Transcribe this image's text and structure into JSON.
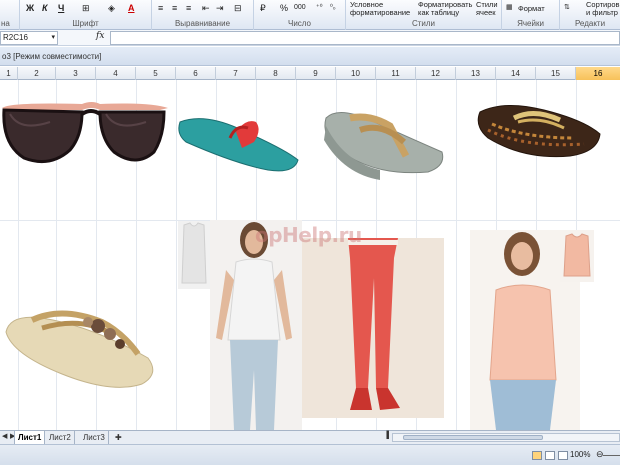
{
  "ribbon": {
    "groups": [
      {
        "label": "на"
      },
      {
        "label": "Шрифт"
      },
      {
        "label": "Выравнивание"
      },
      {
        "label": "Число"
      },
      {
        "label": "Стили"
      },
      {
        "label": "Ячейки"
      },
      {
        "label": "Редакти"
      }
    ],
    "font_buttons": {
      "bold": "Ж",
      "italic": "К",
      "underline": "Ч",
      "color_a": "А"
    },
    "number_buttons": {
      "percent": "%",
      "thousands": "000"
    },
    "styles": {
      "conditional": "Условное форматирование",
      "as_table": "Форматировать как таблицу",
      "cell_styles": "Стили ячеек"
    },
    "cells": {
      "format": "Формат"
    },
    "editing": {
      "sort": "Сортиров и фильтр"
    }
  },
  "formula_bar": {
    "name_box": "R2C16",
    "fx": "fx",
    "formula": ""
  },
  "workbook": {
    "title": "о3  [Режим совместимости]"
  },
  "columns": [
    {
      "label": "1"
    },
    {
      "label": "2"
    },
    {
      "label": "3"
    },
    {
      "label": "4"
    },
    {
      "label": "5"
    },
    {
      "label": "6"
    },
    {
      "label": "7"
    },
    {
      "label": "8"
    },
    {
      "label": "9"
    },
    {
      "label": "10"
    },
    {
      "label": "11"
    },
    {
      "label": "12"
    },
    {
      "label": "13"
    },
    {
      "label": "14"
    },
    {
      "label": "15"
    },
    {
      "label": "16"
    }
  ],
  "active_column": "16",
  "watermark": "opHelp.ru",
  "sheets": [
    {
      "label": "Лист1",
      "active": true
    },
    {
      "label": "Лист2",
      "active": false
    },
    {
      "label": "Лист3",
      "active": false
    }
  ],
  "status": {
    "zoom": "100%"
  },
  "colors": {
    "accent": "#f7c15a",
    "ribbon": "#dfe7f3"
  },
  "images": [
    {
      "name": "sunglasses-image"
    },
    {
      "name": "flipflop-teal-image"
    },
    {
      "name": "wedge-sandal-image"
    },
    {
      "name": "flipflop-brown-image"
    },
    {
      "name": "flower-sandal-image"
    },
    {
      "name": "white-top-model-image"
    },
    {
      "name": "red-jeans-image"
    },
    {
      "name": "peach-blouse-model-image"
    }
  ]
}
